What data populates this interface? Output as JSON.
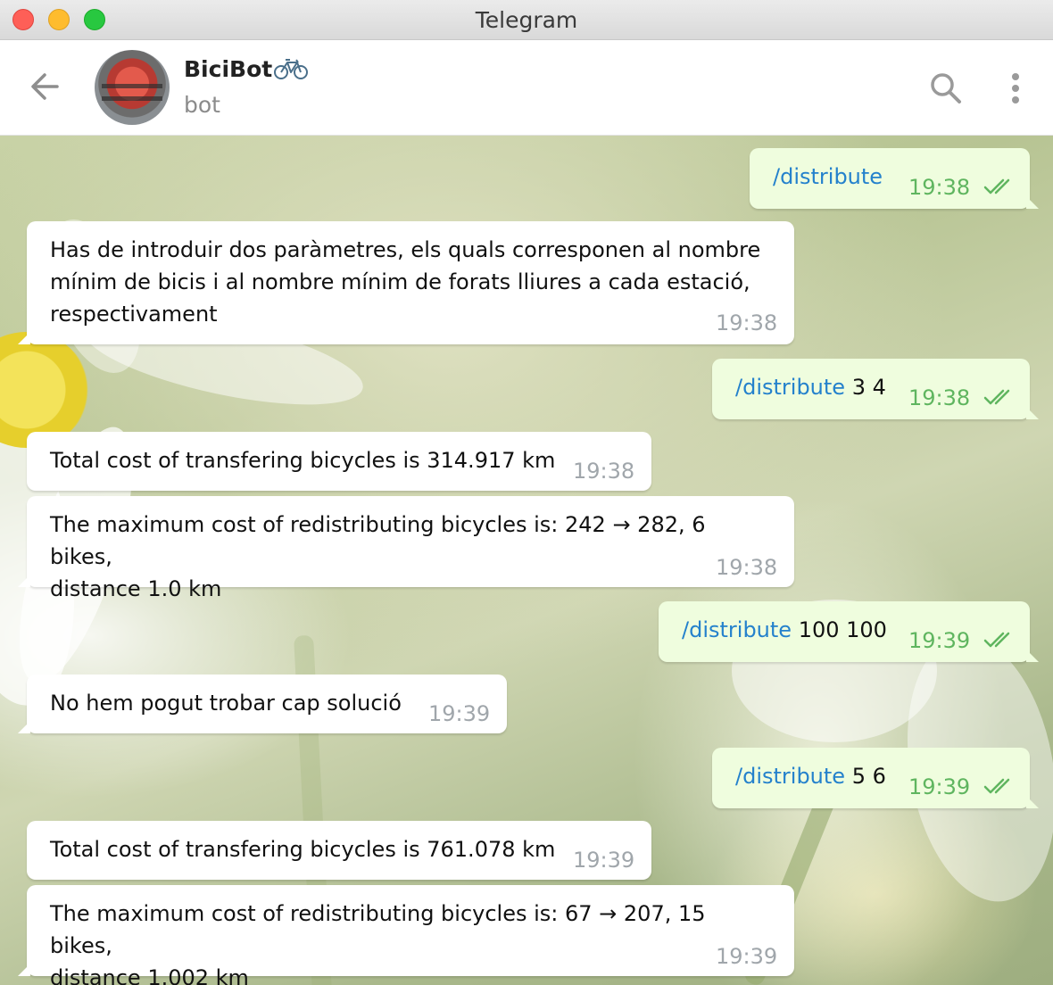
{
  "window": {
    "title": "Telegram"
  },
  "header": {
    "bot_name": "BiciBot",
    "bot_status": "bot",
    "icons": [
      "back-arrow-icon",
      "bicycle-icon",
      "search-icon",
      "more-vertical-icon"
    ]
  },
  "messages": [
    {
      "direction": "out",
      "command": "/distribute",
      "args": "",
      "time": "19:38",
      "read": true
    },
    {
      "direction": "in",
      "text": "Has de introduir dos paràmetres, els quals corresponen al nombre\nmínim de bicis i al nombre mínim de forats lliures a cada estació,\nrespectivament",
      "time": "19:38"
    },
    {
      "direction": "out",
      "command": "/distribute",
      "args": " 3 4",
      "time": "19:38",
      "read": true
    },
    {
      "direction": "in",
      "text": "Total cost of transfering bicycles is 314.917 km",
      "time": "19:38"
    },
    {
      "direction": "in",
      "text": "The maximum cost of redistributing bicycles is: 242 → 282, 6 bikes,\ndistance 1.0 km",
      "time": "19:38"
    },
    {
      "direction": "out",
      "command": "/distribute",
      "args": " 100 100",
      "time": "19:39",
      "read": true
    },
    {
      "direction": "in",
      "text": "No hem pogut trobar cap solució",
      "time": "19:39"
    },
    {
      "direction": "out",
      "command": "/distribute",
      "args": " 5 6",
      "time": "19:39",
      "read": true
    },
    {
      "direction": "in",
      "text": "Total cost of transfering bicycles is 761.078 km",
      "time": "19:39"
    },
    {
      "direction": "in",
      "text": "The maximum cost of redistributing bicycles is: 67 → 207, 15 bikes,\ndistance 1.002 km",
      "time": "19:39"
    }
  ],
  "colors": {
    "outgoing_bubble": "#effdde",
    "incoming_bubble": "#ffffff",
    "command_link": "#2481cc",
    "outgoing_time": "#5fb55f",
    "incoming_time": "#a0a6ab"
  }
}
